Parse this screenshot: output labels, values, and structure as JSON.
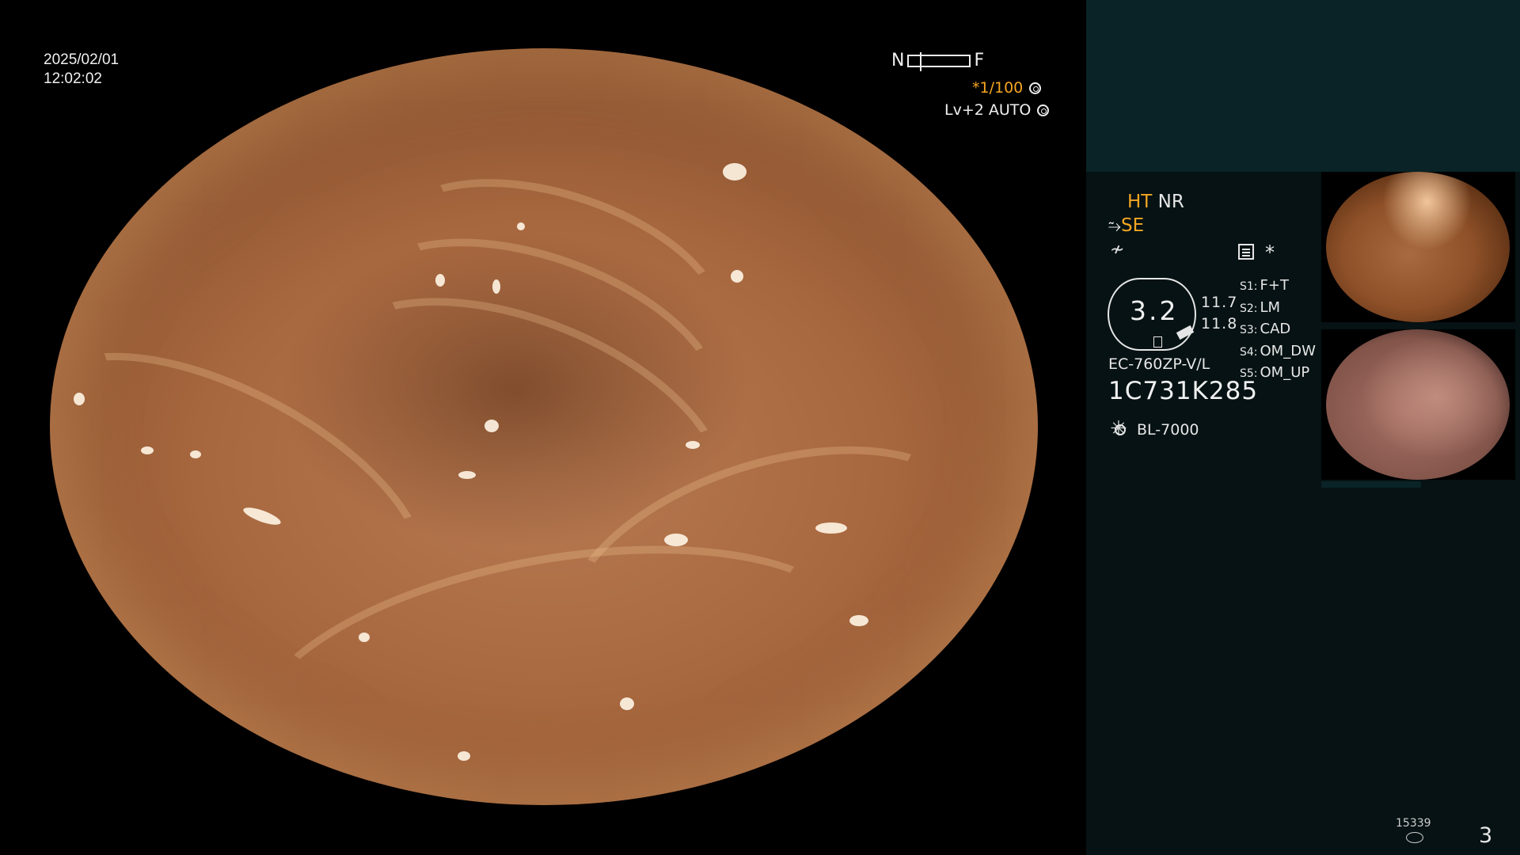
{
  "overlay": {
    "date": "2025/02/01",
    "time": "12:02:02",
    "zoom_near": "N",
    "zoom_far": "F",
    "shutter": "*1/100",
    "level": "Lv+2 AUTO"
  },
  "panel": {
    "ht": "HT",
    "nr": "NR",
    "se": "SE",
    "scope_value": "3.2",
    "value_a": "11.7",
    "value_b": "11.8",
    "model": "EC-760ZP-V/L",
    "serial": "1C731K285",
    "light_source": "BL-7000",
    "switches": [
      {
        "key": "S1:",
        "label": "F+T"
      },
      {
        "key": "S2:",
        "label": "LM"
      },
      {
        "key": "S3:",
        "label": "CAD"
      },
      {
        "key": "S4:",
        "label": "OM_DW"
      },
      {
        "key": "S5:",
        "label": "OM_UP"
      }
    ],
    "frame_count": "15339",
    "page_number": "3"
  },
  "icons": {
    "rotate": "settings-wheel-icon",
    "auto": "auto-circle-icon",
    "document": "document-icon",
    "star": "asterisk-icon",
    "light": "sun-icon",
    "disk": "disk-icon"
  }
}
